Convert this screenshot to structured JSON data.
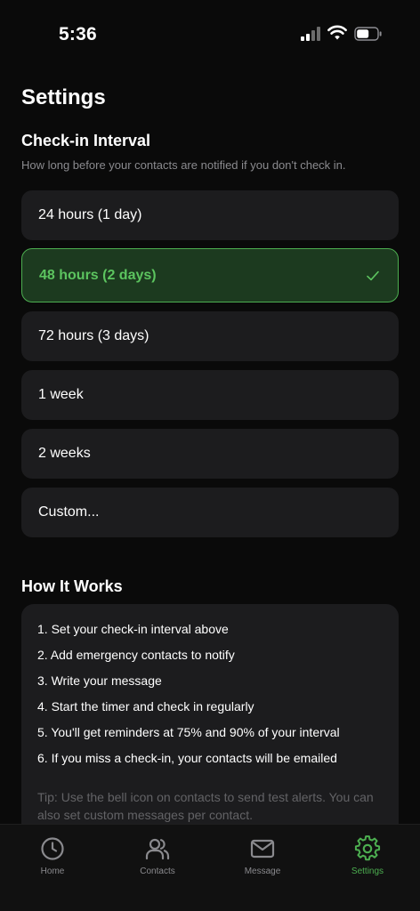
{
  "status_bar": {
    "time": "5:36"
  },
  "page": {
    "title": "Settings"
  },
  "interval": {
    "title": "Check-in Interval",
    "subtitle": "How long before your contacts are notified if you don't check in.",
    "options": [
      {
        "label": "24 hours (1 day)",
        "selected": false
      },
      {
        "label": "48 hours (2 days)",
        "selected": true
      },
      {
        "label": "72 hours (3 days)",
        "selected": false
      },
      {
        "label": "1 week",
        "selected": false
      },
      {
        "label": "2 weeks",
        "selected": false
      },
      {
        "label": "Custom...",
        "selected": false
      }
    ],
    "check_icon": "checkmark-icon"
  },
  "how_it_works": {
    "title": "How It Works",
    "steps": [
      "1. Set your check-in interval above",
      "2. Add emergency contacts to notify",
      "3. Write your message",
      "4. Start the timer and check in regularly",
      "5. You'll get reminders at 75% and 90% of your interval",
      "6. If you miss a check-in, your contacts will be emailed"
    ],
    "tip": "Tip: Use the bell icon on contacts to send test alerts. You can also set custom messages per contact."
  },
  "tab_bar": {
    "tabs": [
      {
        "label": "Home",
        "icon": "clock-icon",
        "active": false
      },
      {
        "label": "Contacts",
        "icon": "users-icon",
        "active": false
      },
      {
        "label": "Message",
        "icon": "envelope-icon",
        "active": false
      },
      {
        "label": "Settings",
        "icon": "gear-icon",
        "active": true
      }
    ]
  },
  "colors": {
    "accent": "#4cae50",
    "background": "#0a0a0a",
    "card": "#1c1c1e",
    "selected_bg": "#1c3a1f"
  }
}
